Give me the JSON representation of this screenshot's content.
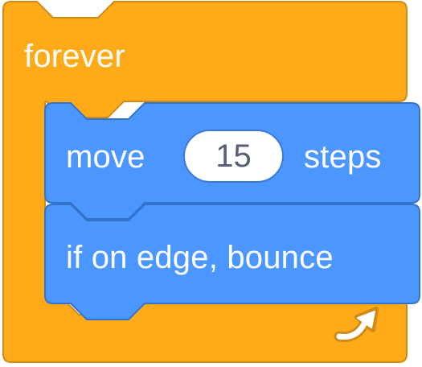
{
  "blocks": {
    "forever": {
      "label": "forever",
      "color": "#ffab19",
      "border_color": "#cf8b17"
    },
    "move": {
      "label_before": "move",
      "steps_value": "15",
      "label_after": "steps",
      "color": "#4c97ff",
      "border_color": "#3373cc"
    },
    "bounce": {
      "label": "if on edge, bounce",
      "color": "#4c97ff",
      "border_color": "#3373cc"
    },
    "loop_icon": "repeat-arrow-icon"
  }
}
